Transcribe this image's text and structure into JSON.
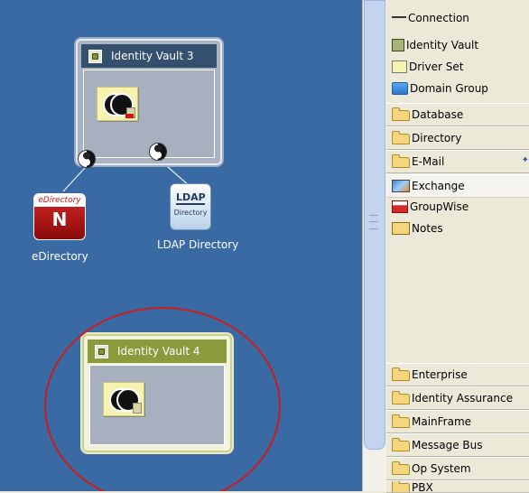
{
  "canvas": {
    "vault3": {
      "title": "Identity Vault 3"
    },
    "vault4": {
      "title": "Identity Vault 4"
    },
    "edirectory": {
      "badge_top": "eDirectory",
      "badge_letter": "N",
      "label": "eDirectory"
    },
    "ldap": {
      "badge_top": "LDAP",
      "badge_bottom": "Directory",
      "label": "LDAP Directory"
    }
  },
  "palette": {
    "items": [
      {
        "label": "Connection",
        "icon": "connection-icon"
      },
      {
        "label": "Identity Vault",
        "icon": "identity-vault-icon"
      },
      {
        "label": "Driver Set",
        "icon": "driver-set-icon"
      },
      {
        "label": "Domain Group",
        "icon": "domain-group-icon"
      }
    ],
    "drawers_top": [
      {
        "label": "Database"
      },
      {
        "label": "Directory"
      },
      {
        "label": "E-Mail"
      }
    ],
    "email_items": [
      {
        "label": "Exchange",
        "icon": "exchange-icon"
      },
      {
        "label": "GroupWise",
        "icon": "groupwise-icon"
      },
      {
        "label": "Notes",
        "icon": "notes-icon"
      }
    ],
    "drawers_bottom": [
      {
        "label": "Enterprise"
      },
      {
        "label": "Identity Assurance"
      },
      {
        "label": "MainFrame"
      },
      {
        "label": "Message Bus"
      },
      {
        "label": "Op System"
      },
      {
        "label": "PBX"
      }
    ]
  },
  "colors": {
    "canvas_bg": "#3a6aa4",
    "vault3_header": "#34506e",
    "vault4_header": "#8a9a3c",
    "highlight": "#c81e1e"
  }
}
